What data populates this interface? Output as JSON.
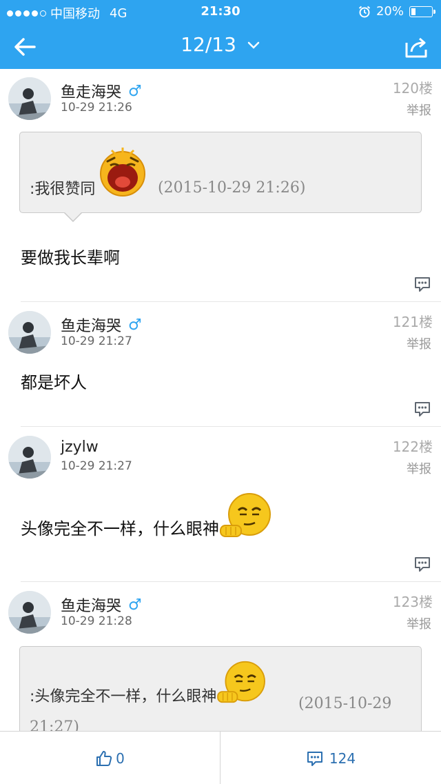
{
  "status_bar": {
    "carrier": "中国移动",
    "network": "4G",
    "time": "21:30",
    "battery": "20%",
    "battery_level": 0.2
  },
  "nav": {
    "back_icon": "arrow-left-icon",
    "page_indicator": "12/13",
    "dropdown_icon": "chevron-down-icon",
    "share_icon": "share-icon"
  },
  "posts": [
    {
      "username": "鱼走海哭",
      "gender": "♂",
      "time": "10-29 21:26",
      "floor": "120楼",
      "report": "举报",
      "quote": {
        "text": ":我很赞同",
        "date": "(2015-10-29 21:26)"
      },
      "content": "要做我长辈啊"
    },
    {
      "username": "鱼走海哭",
      "gender": "♂",
      "time": "10-29 21:27",
      "floor": "121楼",
      "report": "举报",
      "content": "都是坏人"
    },
    {
      "username": "jzylw",
      "time": "10-29 21:27",
      "floor": "122楼",
      "report": "举报",
      "content": "头像完全不一样，什么眼神"
    },
    {
      "username": "鱼走海哭",
      "gender": "♂",
      "time": "10-29 21:28",
      "floor": "123楼",
      "report": "举报",
      "quote": {
        "text": ":头像完全不一样，什么眼神",
        "date": "(2015-10-29",
        "date_cont": "21:27)"
      }
    }
  ],
  "bottom_bar": {
    "like_icon": "thumbs-up-icon",
    "like_count": "0",
    "comment_icon": "comment-icon",
    "comment_count": "124"
  },
  "colors": {
    "header": "#2ea4f0",
    "accent": "#2b6fb0"
  }
}
